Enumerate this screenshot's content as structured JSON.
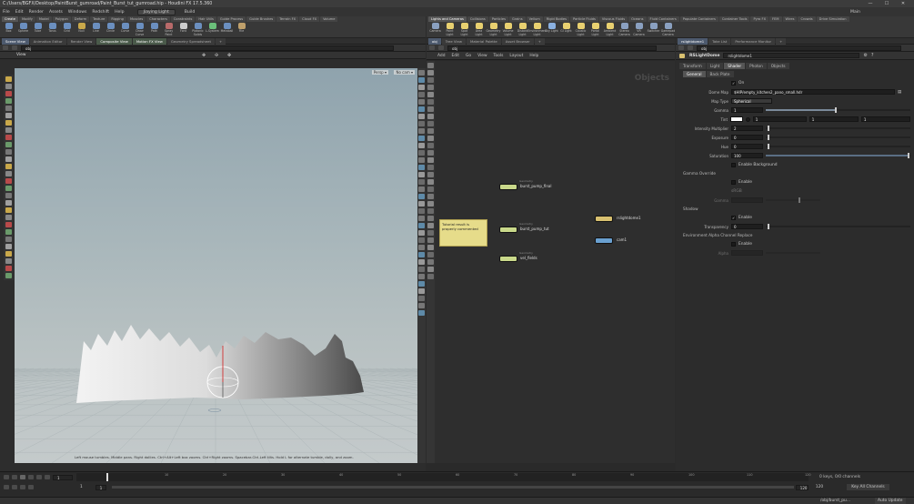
{
  "window": {
    "title": "C:/Users/BGFX/Desktop/PaintBurst_gumroad/Paint_Burst_tut_gumroad.hip - Houdini FX 17.5.360",
    "min": "—",
    "max": "☐",
    "close": "✕"
  },
  "menu": {
    "items": [
      "File",
      "Edit",
      "Render",
      "Assets",
      "Windows",
      "Redshift",
      "Help"
    ],
    "desktop": "Jiaying Light",
    "build": "Build",
    "main": "Main"
  },
  "left_shelf": {
    "tabs": [
      "Create",
      "Modify",
      "Model",
      "Polygon",
      "Deform",
      "Texture",
      "Rigging",
      "Muscles",
      "Characters",
      "Constraints",
      "Hair Utils",
      "Guide Process",
      "Guide Brushes",
      "Terrain FX",
      "Cloud FX",
      "Volume"
    ],
    "active_tab": 0,
    "tools": [
      {
        "label": "Box",
        "color": "#6b8fbf"
      },
      {
        "label": "Sphere",
        "color": "#6b8fbf"
      },
      {
        "label": "Tube",
        "color": "#6b8fbf"
      },
      {
        "label": "Torus",
        "color": "#6b8fbf"
      },
      {
        "label": "Grid",
        "color": "#6b8fbf"
      },
      {
        "label": "Null",
        "color": "#c9a84a"
      },
      {
        "label": "Line",
        "color": "#6b8fbf"
      },
      {
        "label": "Circle",
        "color": "#6b8fbf"
      },
      {
        "label": "Curve",
        "color": "#6b8fbf"
      },
      {
        "label": "Draw Curve",
        "color": "#6b8fbf"
      },
      {
        "label": "Path",
        "color": "#6b8fbf"
      },
      {
        "label": "Spray Paint",
        "color": "#b86a6a"
      },
      {
        "label": "Font",
        "color": "#ccc"
      },
      {
        "label": "Platonic Solids",
        "color": "#6b8fbf"
      },
      {
        "label": "L-System",
        "color": "#6bbf7a"
      },
      {
        "label": "Metaball",
        "color": "#6b8fbf"
      },
      {
        "label": "File",
        "color": "#bfa06b"
      }
    ]
  },
  "right_shelf": {
    "tabs": [
      "Lights and Cameras",
      "Collisions",
      "Particles",
      "Grains",
      "Vellum",
      "Rigid Bodies",
      "Particle Fluids",
      "Viscous Fluids",
      "Oceans",
      "Fluid Containers",
      "Populate Containers",
      "Container Tools",
      "Pyro FX",
      "FEM",
      "Wires",
      "Crowds",
      "Drive Simulation"
    ],
    "active_tab": 0,
    "tools": [
      {
        "label": "Camera",
        "color": "#8aa0c0"
      },
      {
        "label": "Point Light",
        "color": "#e8d070"
      },
      {
        "label": "Spot Light",
        "color": "#e8d070"
      },
      {
        "label": "Area Light",
        "color": "#e8d070"
      },
      {
        "label": "Geometry Light",
        "color": "#e8d070"
      },
      {
        "label": "Volume Light",
        "color": "#e8d070"
      },
      {
        "label": "Distant Light",
        "color": "#e8d070"
      },
      {
        "label": "Environment Light",
        "color": "#e8d070"
      },
      {
        "label": "Sky Light",
        "color": "#8ab0e0"
      },
      {
        "label": "GI Light",
        "color": "#e8d070"
      },
      {
        "label": "Caustic Light",
        "color": "#e8d070"
      },
      {
        "label": "Portal Light",
        "color": "#e8d070"
      },
      {
        "label": "Ambient Light",
        "color": "#e8d070"
      },
      {
        "label": "Stereo Camera",
        "color": "#8aa0c0"
      },
      {
        "label": "VR Camera",
        "color": "#8aa0c0"
      },
      {
        "label": "Switcher",
        "color": "#8aa0c0"
      },
      {
        "label": "Gamepad Camera",
        "color": "#8aa0c0"
      }
    ]
  },
  "viewer": {
    "tabs": [
      "Scene View",
      "Animation Editor",
      "Render View",
      "Composite View",
      "Motion FX View",
      "Geometry Spreadsheet"
    ],
    "active_tab": 0,
    "path": "obj",
    "label": "View",
    "persp": "Persp ▾",
    "cam": "No cam ▾",
    "status": "Left mouse tumbles. Middle pans. Right dollies. Ctrl+Alt+Left box zooms. Ctrl+Right zooms. Spacebar-Ctrl-Left tilts. Hold L for alternate tumble, dolly, and zoom."
  },
  "network": {
    "tabs": [
      "obj",
      "Tree View",
      "Material Palette",
      "Asset Browser"
    ],
    "active_tab": 0,
    "path": "obj",
    "menu": [
      "Add",
      "Edit",
      "Go",
      "View",
      "Tools",
      "Layout",
      "Help"
    ],
    "watermark": "Objects",
    "nodes": [
      {
        "name": "burst_pump_final",
        "type": "Geometry",
        "color": "#c9d88a"
      },
      {
        "name": "burst_pump_tut",
        "type": "Geometry",
        "color": "#c9d88a"
      },
      {
        "name": "vel_fields",
        "type": "Geometry",
        "color": "#c9d88a"
      },
      {
        "name": "rslightdome1",
        "type": "",
        "color": "#d8c070"
      },
      {
        "name": "cam1",
        "type": "",
        "color": "#6aa0d0"
      }
    ],
    "sticky": "Tutorial result is properly commented"
  },
  "params": {
    "tabs": [
      "rslightdome1",
      "Take List",
      "Performance Monitor"
    ],
    "active_tab": 0,
    "path": "obj",
    "node_type": "RSLightDome",
    "node_name": "rslightdome1",
    "main_tabs": [
      "Transform",
      "Light",
      "Shader",
      "Photon",
      "Objects"
    ],
    "main_active": 2,
    "sub_tabs": [
      "General",
      "Back Plate"
    ],
    "sub_active": 0,
    "on_label": "On",
    "dome_map_label": "Dome Map",
    "dome_map": "$HIP/empty_kitchen2_pano_small.hdr",
    "map_type_label": "Map Type",
    "map_type": "Spherical",
    "gamma_label": "Gamma",
    "gamma": "1",
    "tint_label": "Tint",
    "tint": [
      "1",
      "1",
      "1"
    ],
    "intensity_label": "Intensity Multiplier",
    "intensity": "2",
    "exposure_label": "Exposure",
    "exposure": "0",
    "hue_label": "Hue",
    "hue": "0",
    "saturation_label": "Saturation",
    "saturation": "100",
    "enable_bg_label": "Enable Background",
    "gamma_override_label": "Gamma Override",
    "enable_label": "Enable",
    "srgb": "sRGB",
    "gamma2_label": "Gamma",
    "shadow_label": "Shadow",
    "shadow_enable": "Enable",
    "transparency_label": "Transparency",
    "transparency": "0",
    "env_alpha_label": "Environment Alpha Channel Replace",
    "env_enable": "Enable",
    "alpha_label": "Alpha"
  },
  "timeline": {
    "frame": "1",
    "start": "1",
    "end": "120",
    "end2": "120",
    "ticks": [
      "1",
      "10",
      "20",
      "30",
      "40",
      "50",
      "60",
      "70",
      "80",
      "90",
      "100",
      "110",
      "120"
    ],
    "keys": "0 keys, 0/0 channels",
    "key_all": "Key All Channels",
    "auto_update": "Auto Update",
    "hip": "/obj/burst_pu..."
  }
}
